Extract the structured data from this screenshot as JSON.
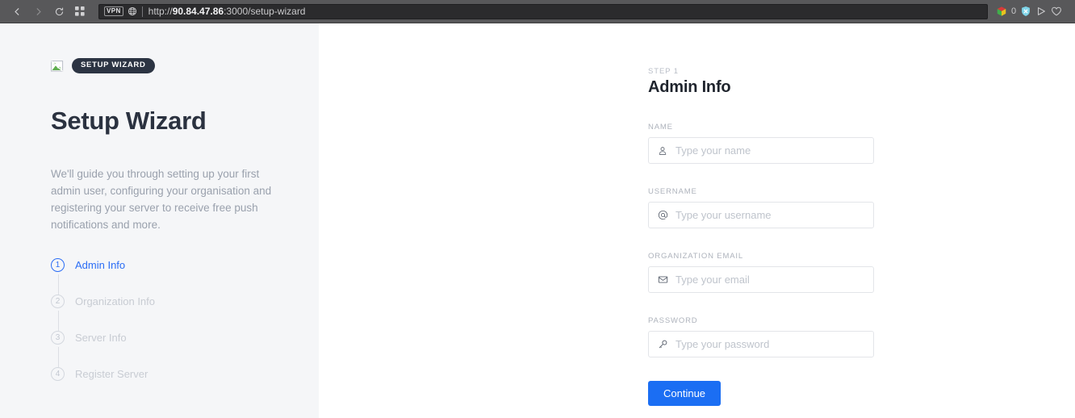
{
  "browser": {
    "back_icon": "chevron-left-icon",
    "forward_icon": "chevron-right-icon",
    "reload_icon": "reload-icon",
    "apps_icon": "grid-apps-icon",
    "vpn_badge": "VPN",
    "globe_icon": "globe-icon",
    "url_scheme": "http://",
    "url_host": "90.84.47.86",
    "url_rest": ":3000/setup-wizard",
    "extensions": {
      "cube_icon": "colored-cube-icon",
      "blocker_count": "0",
      "shield_icon": "shield-block-icon",
      "send_icon": "send-triangle-icon",
      "heart_icon": "heart-icon"
    }
  },
  "sidebar": {
    "logo_icon": "broken-image-icon",
    "badge": "SETUP WIZARD",
    "title": "Setup Wizard",
    "description": "We'll guide you through setting up your first admin user, configuring your organisation and registering your server to receive free push notifications and more.",
    "steps": [
      {
        "number": "1",
        "label": "Admin Info",
        "state": "active"
      },
      {
        "number": "2",
        "label": "Organization Info",
        "state": "inactive"
      },
      {
        "number": "3",
        "label": "Server Info",
        "state": "inactive"
      },
      {
        "number": "4",
        "label": "Register Server",
        "state": "inactive"
      }
    ]
  },
  "form": {
    "kicker": "STEP 1",
    "title": "Admin Info",
    "fields": [
      {
        "label": "NAME",
        "placeholder": "Type your name",
        "value": "",
        "icon": "user-icon",
        "type": "text"
      },
      {
        "label": "USERNAME",
        "placeholder": "Type your username",
        "value": "",
        "icon": "at-icon",
        "type": "text"
      },
      {
        "label": "ORGANIZATION EMAIL",
        "placeholder": "Type your email",
        "value": "",
        "icon": "envelope-icon",
        "type": "text"
      },
      {
        "label": "PASSWORD",
        "placeholder": "Type your password",
        "value": "",
        "icon": "key-icon",
        "type": "password"
      }
    ],
    "submit_label": "Continue"
  },
  "colors": {
    "accent_blue": "#1b6ef3",
    "step_active": "#2b6df5",
    "sidebar_bg": "#f5f6f8",
    "badge_bg": "#2c3443",
    "chrome_bg": "#58585a"
  }
}
